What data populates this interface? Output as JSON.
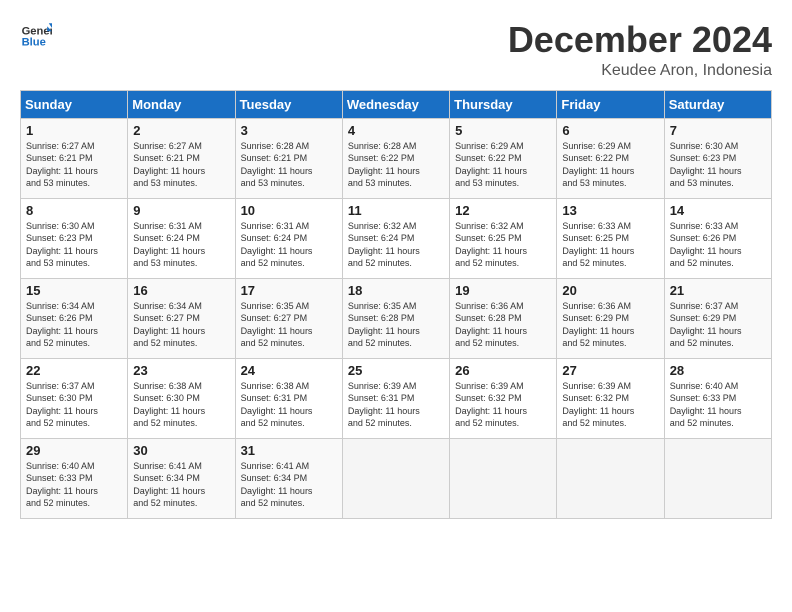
{
  "header": {
    "logo_line1": "General",
    "logo_line2": "Blue",
    "title": "December 2024",
    "subtitle": "Keudee Aron, Indonesia"
  },
  "weekdays": [
    "Sunday",
    "Monday",
    "Tuesday",
    "Wednesday",
    "Thursday",
    "Friday",
    "Saturday"
  ],
  "weeks": [
    [
      {
        "day": "1",
        "info": "Sunrise: 6:27 AM\nSunset: 6:21 PM\nDaylight: 11 hours\nand 53 minutes."
      },
      {
        "day": "2",
        "info": "Sunrise: 6:27 AM\nSunset: 6:21 PM\nDaylight: 11 hours\nand 53 minutes."
      },
      {
        "day": "3",
        "info": "Sunrise: 6:28 AM\nSunset: 6:21 PM\nDaylight: 11 hours\nand 53 minutes."
      },
      {
        "day": "4",
        "info": "Sunrise: 6:28 AM\nSunset: 6:22 PM\nDaylight: 11 hours\nand 53 minutes."
      },
      {
        "day": "5",
        "info": "Sunrise: 6:29 AM\nSunset: 6:22 PM\nDaylight: 11 hours\nand 53 minutes."
      },
      {
        "day": "6",
        "info": "Sunrise: 6:29 AM\nSunset: 6:22 PM\nDaylight: 11 hours\nand 53 minutes."
      },
      {
        "day": "7",
        "info": "Sunrise: 6:30 AM\nSunset: 6:23 PM\nDaylight: 11 hours\nand 53 minutes."
      }
    ],
    [
      {
        "day": "8",
        "info": "Sunrise: 6:30 AM\nSunset: 6:23 PM\nDaylight: 11 hours\nand 53 minutes."
      },
      {
        "day": "9",
        "info": "Sunrise: 6:31 AM\nSunset: 6:24 PM\nDaylight: 11 hours\nand 53 minutes."
      },
      {
        "day": "10",
        "info": "Sunrise: 6:31 AM\nSunset: 6:24 PM\nDaylight: 11 hours\nand 52 minutes."
      },
      {
        "day": "11",
        "info": "Sunrise: 6:32 AM\nSunset: 6:24 PM\nDaylight: 11 hours\nand 52 minutes."
      },
      {
        "day": "12",
        "info": "Sunrise: 6:32 AM\nSunset: 6:25 PM\nDaylight: 11 hours\nand 52 minutes."
      },
      {
        "day": "13",
        "info": "Sunrise: 6:33 AM\nSunset: 6:25 PM\nDaylight: 11 hours\nand 52 minutes."
      },
      {
        "day": "14",
        "info": "Sunrise: 6:33 AM\nSunset: 6:26 PM\nDaylight: 11 hours\nand 52 minutes."
      }
    ],
    [
      {
        "day": "15",
        "info": "Sunrise: 6:34 AM\nSunset: 6:26 PM\nDaylight: 11 hours\nand 52 minutes."
      },
      {
        "day": "16",
        "info": "Sunrise: 6:34 AM\nSunset: 6:27 PM\nDaylight: 11 hours\nand 52 minutes."
      },
      {
        "day": "17",
        "info": "Sunrise: 6:35 AM\nSunset: 6:27 PM\nDaylight: 11 hours\nand 52 minutes."
      },
      {
        "day": "18",
        "info": "Sunrise: 6:35 AM\nSunset: 6:28 PM\nDaylight: 11 hours\nand 52 minutes."
      },
      {
        "day": "19",
        "info": "Sunrise: 6:36 AM\nSunset: 6:28 PM\nDaylight: 11 hours\nand 52 minutes."
      },
      {
        "day": "20",
        "info": "Sunrise: 6:36 AM\nSunset: 6:29 PM\nDaylight: 11 hours\nand 52 minutes."
      },
      {
        "day": "21",
        "info": "Sunrise: 6:37 AM\nSunset: 6:29 PM\nDaylight: 11 hours\nand 52 minutes."
      }
    ],
    [
      {
        "day": "22",
        "info": "Sunrise: 6:37 AM\nSunset: 6:30 PM\nDaylight: 11 hours\nand 52 minutes."
      },
      {
        "day": "23",
        "info": "Sunrise: 6:38 AM\nSunset: 6:30 PM\nDaylight: 11 hours\nand 52 minutes."
      },
      {
        "day": "24",
        "info": "Sunrise: 6:38 AM\nSunset: 6:31 PM\nDaylight: 11 hours\nand 52 minutes."
      },
      {
        "day": "25",
        "info": "Sunrise: 6:39 AM\nSunset: 6:31 PM\nDaylight: 11 hours\nand 52 minutes."
      },
      {
        "day": "26",
        "info": "Sunrise: 6:39 AM\nSunset: 6:32 PM\nDaylight: 11 hours\nand 52 minutes."
      },
      {
        "day": "27",
        "info": "Sunrise: 6:39 AM\nSunset: 6:32 PM\nDaylight: 11 hours\nand 52 minutes."
      },
      {
        "day": "28",
        "info": "Sunrise: 6:40 AM\nSunset: 6:33 PM\nDaylight: 11 hours\nand 52 minutes."
      }
    ],
    [
      {
        "day": "29",
        "info": "Sunrise: 6:40 AM\nSunset: 6:33 PM\nDaylight: 11 hours\nand 52 minutes."
      },
      {
        "day": "30",
        "info": "Sunrise: 6:41 AM\nSunset: 6:34 PM\nDaylight: 11 hours\nand 52 minutes."
      },
      {
        "day": "31",
        "info": "Sunrise: 6:41 AM\nSunset: 6:34 PM\nDaylight: 11 hours\nand 52 minutes."
      },
      null,
      null,
      null,
      null
    ]
  ]
}
